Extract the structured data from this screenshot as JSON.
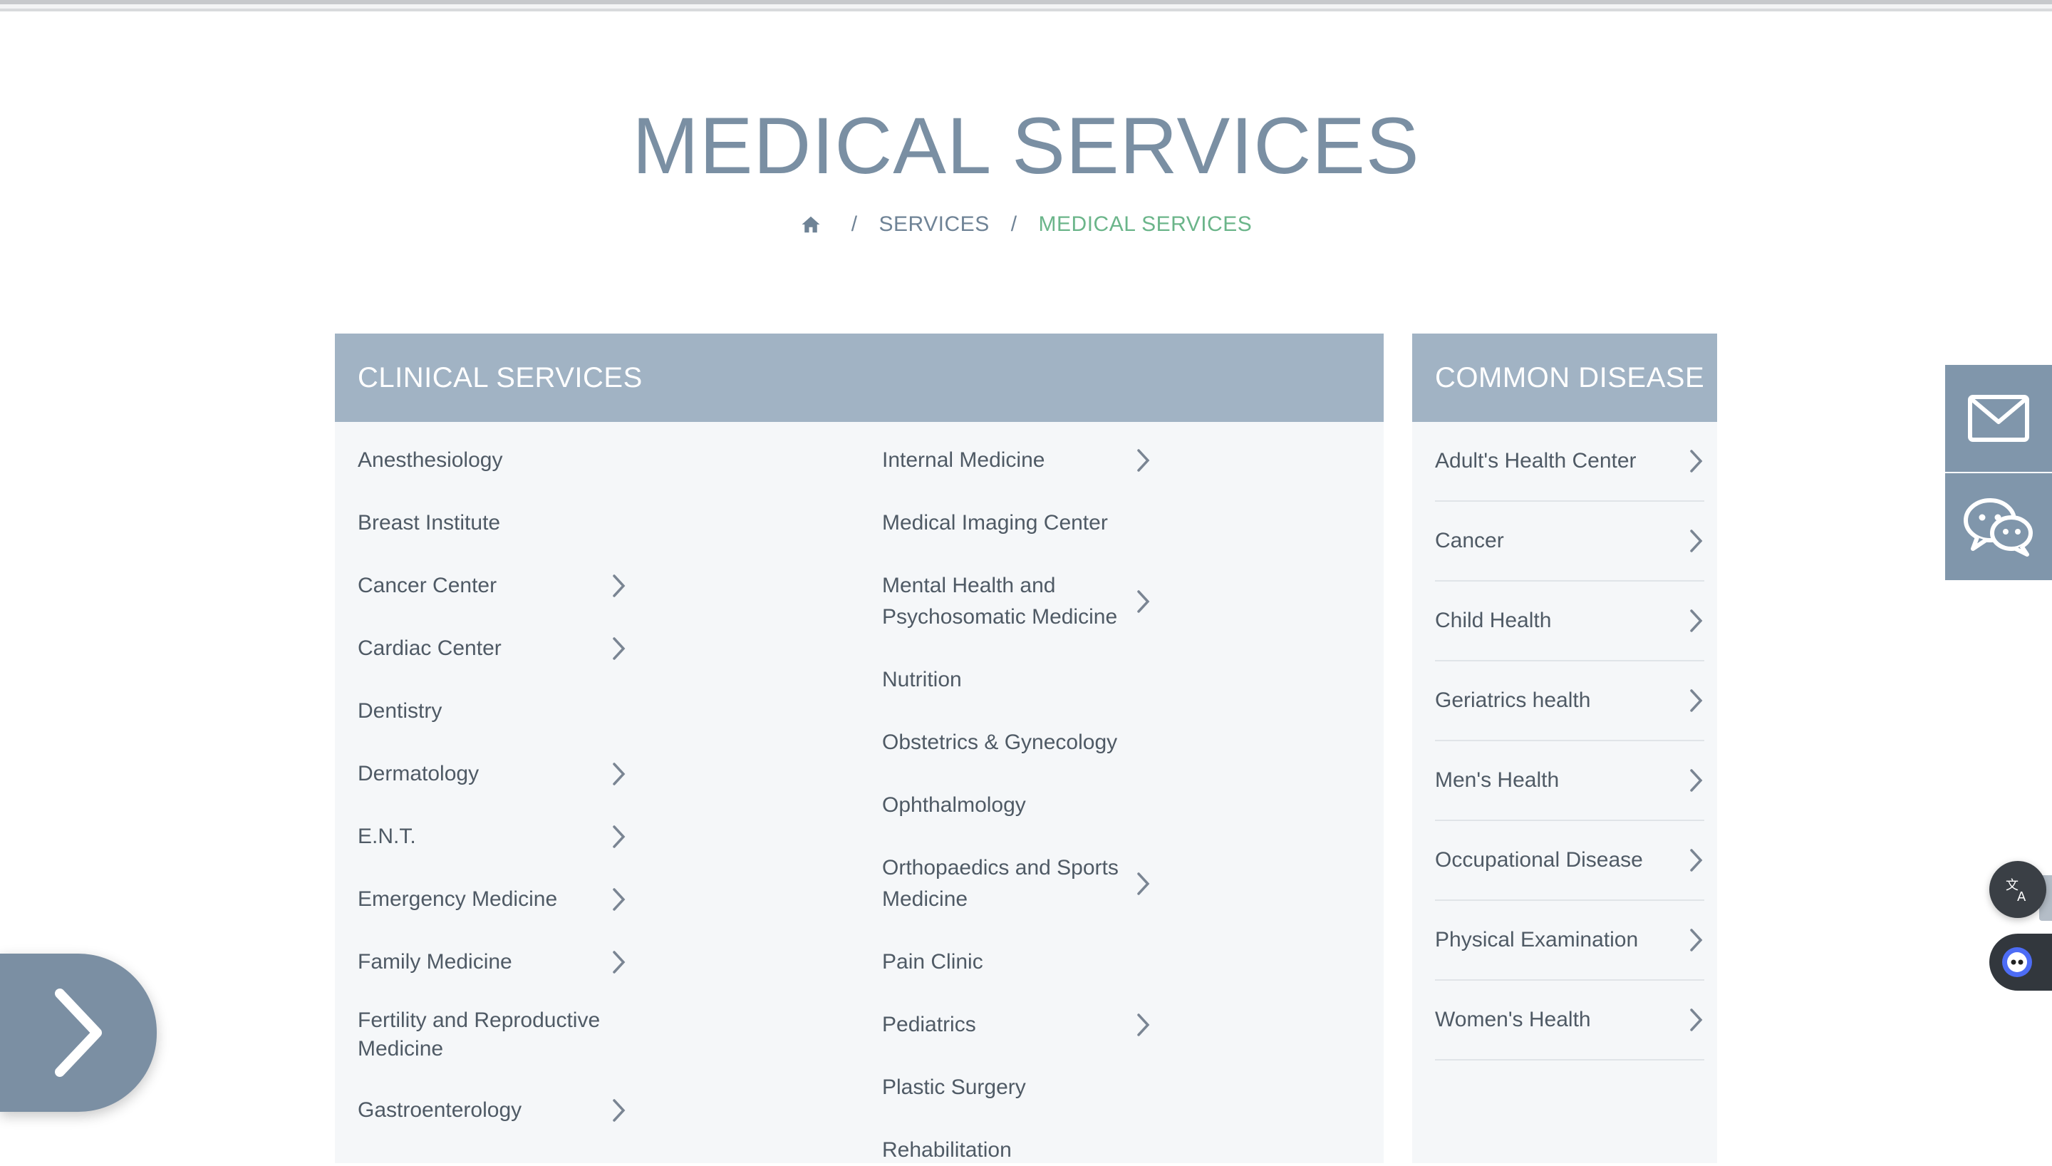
{
  "page": {
    "title": "MEDICAL SERVICES"
  },
  "breadcrumb": {
    "home_icon": "home-icon",
    "items": [
      "SERVICES",
      "MEDICAL SERVICES"
    ],
    "separator": "/"
  },
  "clinical": {
    "header": "CLINICAL SERVICES",
    "left_column": [
      {
        "label": "Anesthesiology",
        "has_arrow": false
      },
      {
        "label": "Breast Institute",
        "has_arrow": false
      },
      {
        "label": "Cancer Center",
        "has_arrow": true
      },
      {
        "label": "Cardiac Center",
        "has_arrow": true
      },
      {
        "label": "Dentistry",
        "has_arrow": false
      },
      {
        "label": "Dermatology",
        "has_arrow": true
      },
      {
        "label": "E.N.T.",
        "has_arrow": true
      },
      {
        "label": "Emergency Medicine",
        "has_arrow": true
      },
      {
        "label": "Family Medicine",
        "has_arrow": true
      },
      {
        "label": "Fertility and Reproductive Medicine",
        "has_arrow": false
      },
      {
        "label": "Gastroenterology",
        "has_arrow": true
      }
    ],
    "mid_column": [
      {
        "label": "Internal Medicine",
        "has_arrow": true
      },
      {
        "label": "Medical Imaging Center",
        "has_arrow": false
      },
      {
        "label": "Mental Health and Psychosomatic Medicine",
        "has_arrow": true
      },
      {
        "label": "Nutrition",
        "has_arrow": false
      },
      {
        "label": "Obstetrics & Gynecology",
        "has_arrow": false
      },
      {
        "label": "Ophthalmology",
        "has_arrow": false
      },
      {
        "label": "Orthopaedics and Sports Medicine",
        "has_arrow": true
      },
      {
        "label": "Pain Clinic",
        "has_arrow": false
      },
      {
        "label": "Pediatrics",
        "has_arrow": true
      },
      {
        "label": "Plastic Surgery",
        "has_arrow": false
      },
      {
        "label": "Rehabilitation",
        "has_arrow": false
      }
    ]
  },
  "common": {
    "header": "COMMON DISEASE",
    "items": [
      "Adult's Health Center",
      "Cancer",
      "Child Health",
      "Geriatrics health",
      "Men's Health",
      "Occupational Disease",
      "Physical Examination",
      "Women's Health"
    ]
  },
  "side_tools": {
    "mail_icon": "mail-icon",
    "chat_icon": "chat-icon",
    "translate_icon": "translate-icon",
    "assistant_icon": "assistant-icon",
    "next_icon": "chevron-right-icon"
  },
  "colors": {
    "title": "#7a8fa3",
    "accent_green": "#6bb58a",
    "header_bg": "#a1b3c4",
    "side_button": "#8096ab"
  }
}
